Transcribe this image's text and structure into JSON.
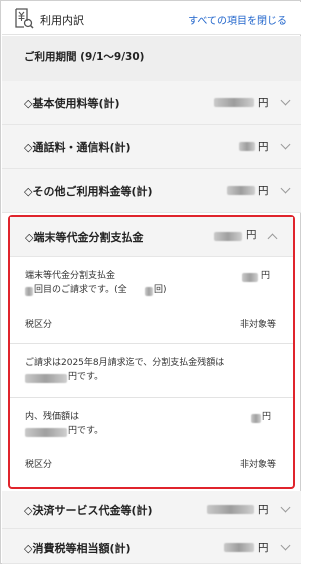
{
  "header": {
    "title": "利用内訳",
    "collapse_all_link": "すべての項目を閉じる",
    "icon": "receipt-yen-icon"
  },
  "period": {
    "label": "ご利用期間 (9/1〜9/30)"
  },
  "rows": {
    "basic": {
      "label": "◇基本使用料等(計)",
      "unit": "円"
    },
    "calls": {
      "label": "◇通話料・通信料(計)",
      "unit": "円"
    },
    "other": {
      "label": "◇その他ご利用料金等(計)",
      "unit": "円"
    },
    "payment": {
      "label": "◇決済サービス代金等(計)",
      "unit": "円"
    },
    "tax": {
      "label": "◇消費税等相当額(計)",
      "unit": "円"
    }
  },
  "installment": {
    "label": "◇端末等代金分割支払金",
    "unit": "円",
    "detail_title": "端末等代金分割支払金",
    "detail_unit": "円",
    "detail_line2": "回目のご請求です。(全",
    "detail_line2_end": "回)",
    "tax_label": "税区分",
    "tax_value": "非対象等",
    "notice_line1": "ご請求は2025年8月請求迄で、分割支払金残額は",
    "notice_line2": "円です。",
    "of_which_label": "内、残価額は",
    "of_which_unit": "円",
    "of_which_line2": "円です。",
    "tax_label2": "税区分",
    "tax_value2": "非対象等"
  },
  "colors": {
    "accent": "#e0242c",
    "link": "#2266cc"
  }
}
